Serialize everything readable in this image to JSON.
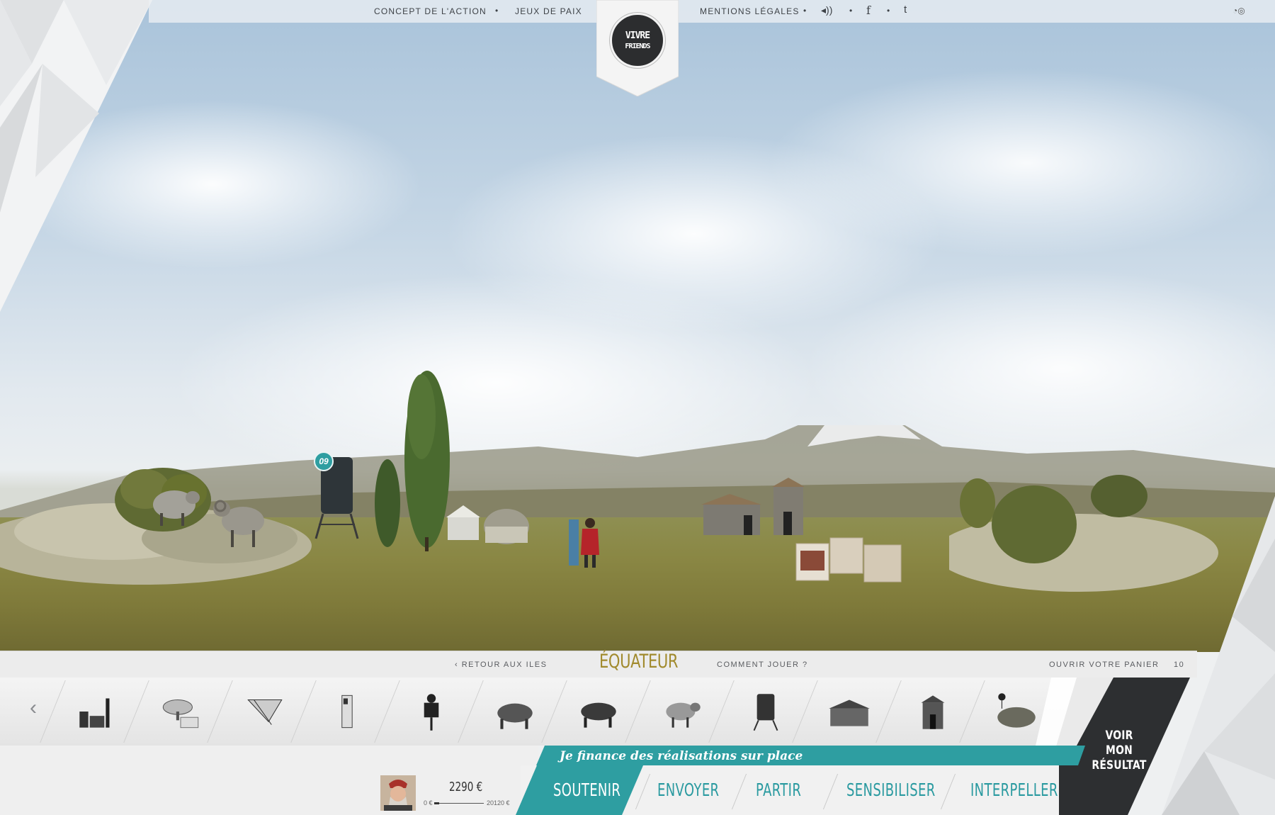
{
  "topnav": {
    "left_links": [
      "CONCEPT DE L'ACTION",
      "JEUX DE PAIX"
    ],
    "right_links": [
      "MENTIONS LÉGALES"
    ],
    "sound_icon": "sound-icon",
    "facebook_icon": "facebook-icon",
    "twitter_icon": "twitter-icon",
    "corner_icon": "share-icon"
  },
  "logo": {
    "line1": "VIVRE",
    "line2": "FRIENDS"
  },
  "scene": {
    "marker_label": "09",
    "accent_color": "#2e9ea1"
  },
  "infobar": {
    "back_label": "‹ RETOUR AUX ILES",
    "country": "ÉQUATEUR",
    "how_to_play": "COMMENT JOUER ?",
    "open_basket": "OUVRIR VOTRE PANIER",
    "basket_count": "10"
  },
  "tray": {
    "items": [
      {
        "name": "factory-icon"
      },
      {
        "name": "satellite-dish-icon"
      },
      {
        "name": "canopy-icon"
      },
      {
        "name": "water-pump-icon"
      },
      {
        "name": "scarecrow-icon"
      },
      {
        "name": "bull-icon"
      },
      {
        "name": "ox-icon"
      },
      {
        "name": "sheep-icon"
      },
      {
        "name": "water-tank-icon"
      },
      {
        "name": "hut-icon"
      },
      {
        "name": "house-icon"
      },
      {
        "name": "shrub-icon"
      }
    ],
    "prev_icon": "chevron-left-icon",
    "next_icon": "chevron-right-icon"
  },
  "voir": {
    "line1": "VOIR MON",
    "line2": "RÉSULTAT"
  },
  "finance_banner": "Je finance des réalisations sur place",
  "tabs": [
    "SOUTENIR",
    "ENVOYER",
    "PARTIR",
    "SENSIBILISER",
    "INTERPELLER"
  ],
  "active_tab": "SOUTENIR",
  "score": {
    "value": "2290 €",
    "min": "0 €",
    "max": "20120 €",
    "progress_fraction": 0.1
  }
}
